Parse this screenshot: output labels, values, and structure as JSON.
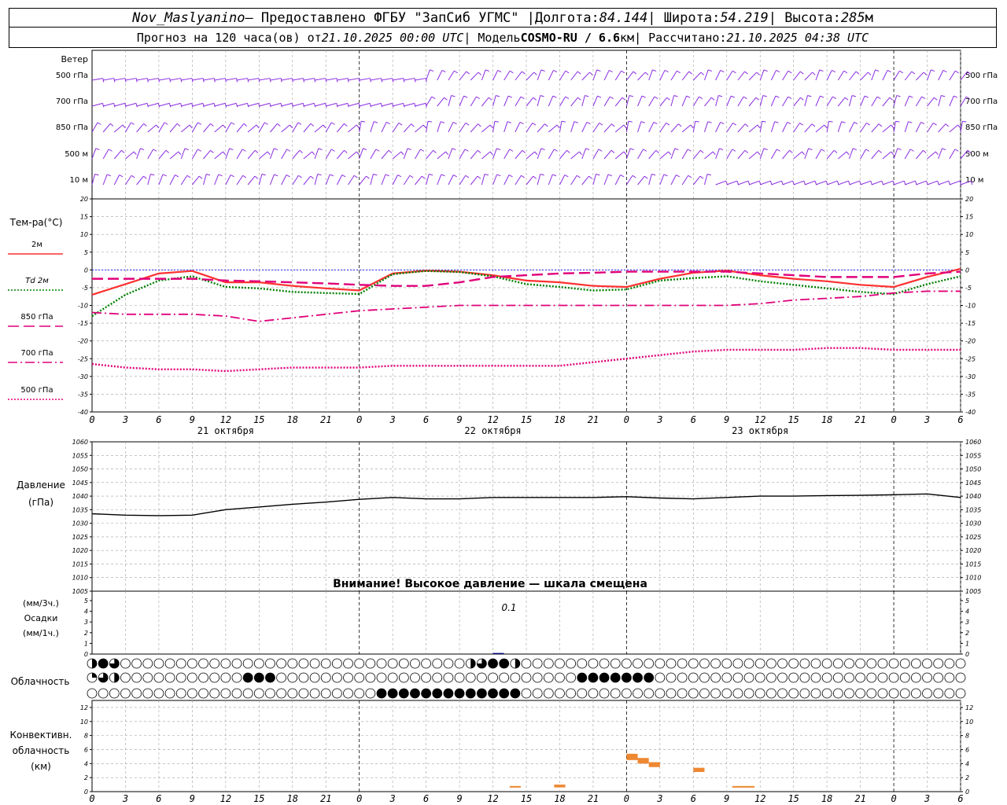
{
  "header": {
    "station": "Nov_Maslyanino",
    "provider": "— Предоставлено ФГБУ \"ЗапСиб УГМС\" |",
    "lon_label": "Долгота:",
    "lon": "84.144",
    "lat_label": "| Широта:",
    "lat": "54.219",
    "alt_label": "| Высота:",
    "alt": "285",
    "alt_unit": "м",
    "forecast_label": "Прогноз на 120 часа(ов) от",
    "forecast_date": "21.10.2025 00:00 UTC",
    "model_label": "| Модель",
    "model": "COSMO-RU / 6.6",
    "model_unit": "км",
    "calc_label": "| Рассчитано:",
    "calc_date": "21.10.2025 04:38 UTC"
  },
  "colors": {
    "wind": "#8a2be2",
    "t2m": "#ff3030",
    "td2m": "#008000",
    "t850": "#e0007a",
    "t700": "#e0007a",
    "t500": "#e0007a",
    "pressure": "#000000",
    "precip": "#000080",
    "convective": "#ee8833",
    "grid": "#a0a0a0",
    "zeroline": "#0000ff"
  },
  "wind_panel": {
    "title": "Ветер",
    "levels": [
      "500 гПа",
      "700 гПа",
      "850 гПа",
      "500 м",
      "10 м"
    ]
  },
  "time_axis": {
    "tick_labels": [
      "0",
      "3",
      "6",
      "9",
      "12",
      "15",
      "18",
      "21",
      "0",
      "3",
      "6",
      "9",
      "12",
      "15",
      "18",
      "21",
      "0",
      "3",
      "6",
      "9",
      "12",
      "15",
      "18",
      "21",
      "0",
      "3",
      "6"
    ],
    "dates": [
      "21 октября",
      "22 октября",
      "23 октября"
    ]
  },
  "chart_data": [
    {
      "type": "line",
      "name_label": "Тем-ра(°С)",
      "legend": [
        "2м",
        "Td  2м",
        "850 гПа",
        "700 гПа",
        "500 гПа"
      ],
      "x_hours": [
        0,
        3,
        6,
        9,
        12,
        15,
        18,
        21,
        24,
        27,
        30,
        33,
        36,
        39,
        42,
        45,
        48,
        51,
        54,
        57,
        60,
        63,
        66,
        69,
        72,
        75,
        78
      ],
      "ylim": [
        -40,
        20
      ],
      "yticks": [
        -40,
        -35,
        -30,
        -25,
        -20,
        -15,
        -10,
        -5,
        0,
        5,
        10,
        15,
        20
      ],
      "series": [
        {
          "key": "t2m",
          "values": [
            -7,
            -4,
            -1,
            -0.3,
            -3.5,
            -3.5,
            -4.5,
            -5.2,
            -5.8,
            -1,
            -0.2,
            -0.5,
            -1.5,
            -3,
            -3.5,
            -4.5,
            -4.8,
            -2.5,
            -0.8,
            -0.2,
            -1.5,
            -2.5,
            -3.2,
            -4.2,
            -4.8,
            -2,
            0.3
          ]
        },
        {
          "key": "td2m",
          "values": [
            -13,
            -7,
            -3,
            -1.8,
            -4.8,
            -5.2,
            -6.2,
            -6.5,
            -6.8,
            -1.2,
            -0.3,
            -0.6,
            -1.8,
            -4,
            -4.8,
            -5.8,
            -5.5,
            -3,
            -2.3,
            -1.8,
            -3.2,
            -4.2,
            -5.2,
            -6.2,
            -6.8,
            -4,
            -1.8
          ]
        },
        {
          "key": "t850",
          "values": [
            -2.5,
            -2.5,
            -2.5,
            -2.5,
            -3,
            -3.2,
            -3.5,
            -3.8,
            -4.2,
            -4.5,
            -4.5,
            -3.5,
            -2,
            -1.5,
            -1,
            -0.8,
            -0.5,
            -0.5,
            -0.5,
            -0.5,
            -1,
            -1.5,
            -2,
            -2,
            -2,
            -1,
            -0.5
          ]
        },
        {
          "key": "t700",
          "values": [
            -12,
            -12.5,
            -12.5,
            -12.5,
            -13,
            -14.5,
            -13.5,
            -12.5,
            -11.5,
            -11,
            -10.5,
            -10,
            -10,
            -10,
            -10,
            -10,
            -10,
            -10,
            -10,
            -10,
            -9.5,
            -8.5,
            -8,
            -7.5,
            -6.5,
            -6,
            -6
          ]
        },
        {
          "key": "t500",
          "values": [
            -26.5,
            -27.5,
            -28,
            -28,
            -28.5,
            -28,
            -27.5,
            -27.5,
            -27.5,
            -27,
            -27,
            -27,
            -27,
            -27,
            -27,
            -26,
            -25,
            -24,
            -23,
            -22.5,
            -22.5,
            -22.5,
            -22,
            -22,
            -22.5,
            -22.5,
            -22.5
          ]
        }
      ]
    },
    {
      "type": "line",
      "name_label": "Давление",
      "unit_label": "(гПа)",
      "warning": "Внимание! Высокое давление — шкала смещена",
      "x_hours": [
        0,
        3,
        6,
        9,
        12,
        15,
        18,
        21,
        24,
        27,
        30,
        33,
        36,
        39,
        42,
        45,
        48,
        51,
        54,
        57,
        60,
        63,
        66,
        69,
        72,
        75,
        78
      ],
      "ylim": [
        1005,
        1060
      ],
      "yticks": [
        1005,
        1010,
        1015,
        1020,
        1025,
        1030,
        1035,
        1040,
        1045,
        1050,
        1055,
        1060
      ],
      "series": [
        {
          "key": "pressure",
          "values": [
            1033.5,
            1033,
            1032.8,
            1033,
            1035,
            1036,
            1037,
            1037.8,
            1038.8,
            1039.5,
            1039,
            1039,
            1039.5,
            1039.5,
            1039.5,
            1039.5,
            1039.8,
            1039.3,
            1039,
            1039.5,
            1040,
            1040,
            1040.2,
            1040.3,
            1040.5,
            1040.8,
            1039.5
          ]
        }
      ]
    },
    {
      "type": "bar",
      "name_label": "(мм/3ч.)",
      "name_label2": "Осадки",
      "name_label3": "(мм/1ч.)",
      "ylim": [
        0,
        5
      ],
      "yticks": [
        0,
        1,
        2,
        3,
        4,
        5
      ],
      "annotation": "0.1",
      "x_hours": [
        36
      ],
      "values": [
        0.1
      ]
    },
    {
      "type": "table",
      "name_label": "Облачность",
      "rows": [
        {
          "level": "upper",
          "cover_octas_every_hour": [
            4,
            8,
            6,
            0,
            0,
            0,
            0,
            0,
            0,
            0,
            0,
            0,
            0,
            0,
            0,
            0,
            0,
            0,
            0,
            0,
            0,
            0,
            0,
            0,
            0,
            0,
            0,
            0,
            0,
            0,
            0,
            0,
            0,
            0,
            0,
            0,
            0,
            0,
            0,
            0,
            0,
            0,
            0,
            0,
            0,
            0,
            0,
            0,
            0,
            0,
            0,
            0,
            0,
            0,
            0,
            0,
            0,
            0,
            0,
            0,
            0,
            0,
            0,
            0,
            0,
            0,
            0,
            0,
            0,
            0,
            0,
            0,
            0,
            0,
            0,
            0,
            0,
            0,
            0
          ]
        },
        {
          "level": "middle",
          "cover_octas_every_hour": [
            2,
            6,
            4,
            0,
            0,
            0,
            0,
            0,
            0,
            0,
            0,
            0,
            0,
            0,
            0,
            0,
            0,
            0,
            0,
            0,
            0,
            0,
            0,
            0,
            0,
            0,
            0,
            0,
            0,
            0,
            0,
            0,
            0,
            0,
            0,
            0,
            0,
            0,
            0,
            0,
            0,
            0,
            0,
            0,
            0,
            0,
            0,
            0,
            0,
            0,
            0,
            0,
            0,
            0,
            0,
            0,
            0,
            0,
            0,
            0,
            0,
            0,
            0,
            0,
            0,
            0,
            0,
            0,
            0,
            0,
            0,
            0,
            0,
            0,
            0,
            0,
            0,
            0,
            0
          ]
        },
        {
          "level": "lower",
          "cover_octas_every_hour": [
            0,
            0,
            0,
            0,
            0,
            0,
            0,
            0,
            0,
            0,
            0,
            0,
            0,
            0,
            0,
            0,
            0,
            0,
            0,
            0,
            0,
            0,
            0,
            0,
            0,
            0,
            0,
            0,
            0,
            0,
            0,
            0,
            0,
            0,
            0,
            0,
            0,
            0,
            0,
            0,
            0,
            0,
            0,
            0,
            0,
            0,
            0,
            0,
            0,
            0,
            0,
            0,
            0,
            0,
            0,
            0,
            0,
            0,
            0,
            0,
            0,
            0,
            0,
            0,
            0,
            0,
            0,
            0,
            0,
            0,
            0,
            0,
            0,
            0,
            0,
            0,
            0,
            0,
            0
          ]
        }
      ]
    },
    {
      "type": "bar",
      "name_label": "Конвективн.",
      "name_label2": "облачность",
      "name_label3": "(км)",
      "ylim": [
        0,
        13
      ],
      "yticks": [
        0,
        2,
        4,
        6,
        8,
        10,
        12
      ],
      "segments": [
        {
          "x_start": 37.5,
          "x_end": 38.5,
          "base_km": 0.6,
          "top_km": 0.8
        },
        {
          "x_start": 41.5,
          "x_end": 42.5,
          "base_km": 0.6,
          "top_km": 1.0
        },
        {
          "x_start": 48,
          "x_end": 49,
          "base_km": 4.5,
          "top_km": 5.4
        },
        {
          "x_start": 49,
          "x_end": 50,
          "base_km": 4.0,
          "top_km": 4.8
        },
        {
          "x_start": 50,
          "x_end": 51,
          "base_km": 3.5,
          "top_km": 4.2
        },
        {
          "x_start": 54,
          "x_end": 55,
          "base_km": 2.8,
          "top_km": 3.4
        },
        {
          "x_start": 57.5,
          "x_end": 59.5,
          "base_km": 0.6,
          "top_km": 0.8
        }
      ]
    }
  ]
}
